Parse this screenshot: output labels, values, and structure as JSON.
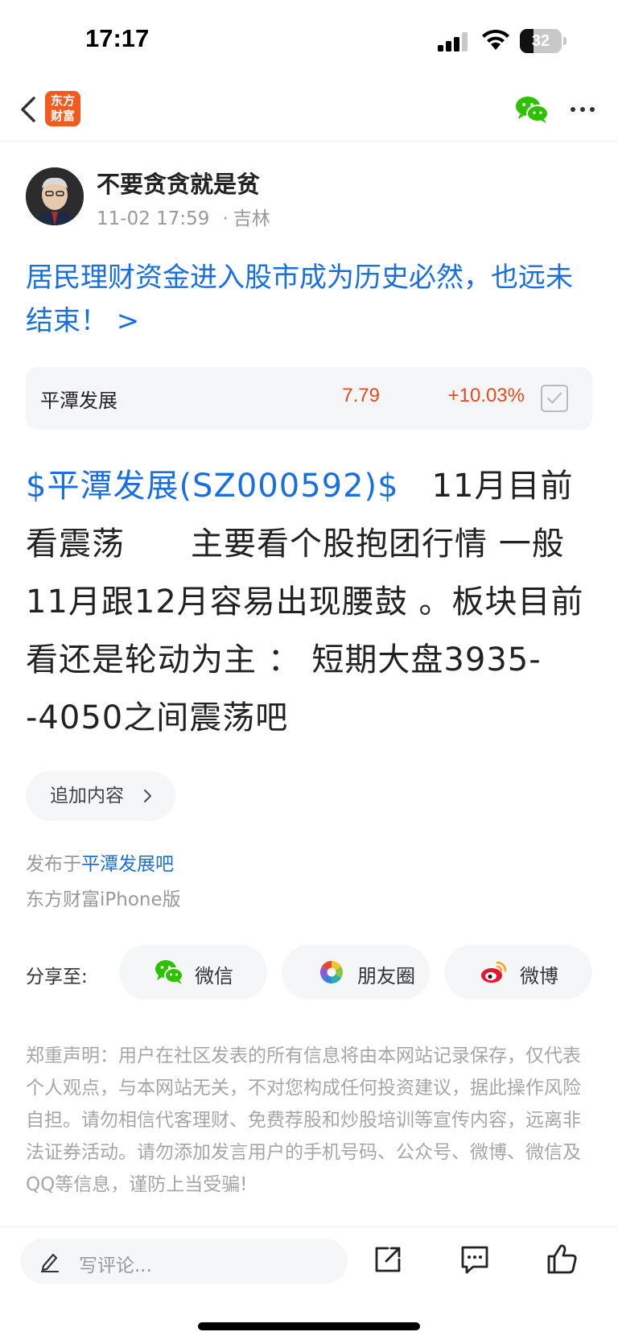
{
  "status_bar": {
    "time": "17:17",
    "battery": "32",
    "battery_level": 0.32
  },
  "nav": {
    "logo_line1": "东方",
    "logo_line2": "财富"
  },
  "author": {
    "name": "不要贪贪就是贫",
    "date": "11-02 17:59",
    "location": "吉林"
  },
  "post": {
    "title": "居民理财资金进入股市成为历史必然，也远未结束！ >",
    "stock_link": "$平潭发展(SZ000592)$",
    "body": "　11月目前看震荡　　主要看个股抱团行情 一般11月跟12月容易出现腰鼓 。板块目前看还是轮动为主 ： 短期大盘3935--4050之间震荡吧"
  },
  "stock_card": {
    "name": "平潭发展",
    "price": "7.79",
    "change": "+10.03%"
  },
  "append": {
    "label": "追加内容"
  },
  "published": {
    "prefix": "发布于",
    "forum": "平潭发展吧",
    "client": "东方财富iPhone版"
  },
  "share": {
    "label": "分享至:",
    "wechat": "微信",
    "moments": "朋友圈",
    "weibo": "微博"
  },
  "disclaimer": "郑重声明：用户在社区发表的所有信息将由本网站记录保存，仅代表个人观点，与本网站无关，不对您构成任何投资建议，据此操作风险自担。请勿相信代客理财、免费荐股和炒股培训等宣传内容，远离非法证券活动。请勿添加发言用户的手机号码、公众号、微博、微信及QQ等信息，谨防上当受骗!",
  "bottom_bar": {
    "comment_placeholder": "写评论..."
  },
  "colors": {
    "link_blue": "#1a6fe0",
    "stock_up_red": "#e8491d",
    "brand_orange": "#f25a1e",
    "wechat_green": "#2dc100"
  }
}
